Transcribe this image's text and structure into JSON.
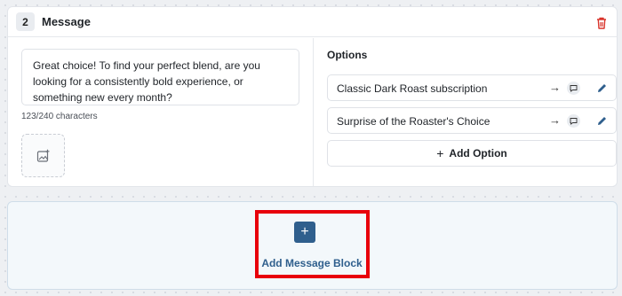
{
  "card": {
    "step_number": "2",
    "title": "Message",
    "message_text": "Great choice! To find your perfect blend, are you looking for a consistently bold experience, or something new every month?",
    "char_count": "123/240 characters",
    "delete_icon": "trash-icon",
    "image_icon": "add-image-icon"
  },
  "options": {
    "title": "Options",
    "items": [
      {
        "label": "Classic Dark Roast subscription",
        "arrow": "→"
      },
      {
        "label": "Surprise of the Roaster's Choice",
        "arrow": "→"
      }
    ],
    "add_label": "Add Option",
    "add_plus": "+"
  },
  "add_block": {
    "plus": "+",
    "label": "Add Message Block"
  },
  "colors": {
    "accent": "#2f5f8d",
    "delete": "#d9342b",
    "highlight": "#e8000b"
  }
}
